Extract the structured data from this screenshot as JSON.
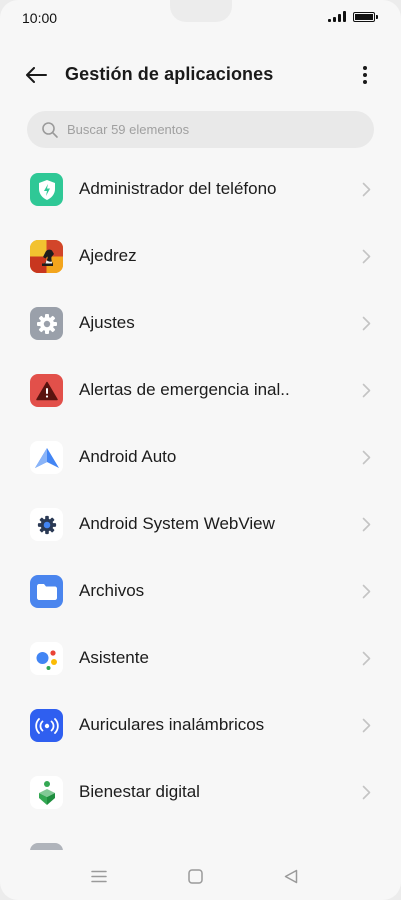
{
  "status_bar": {
    "time": "10:00"
  },
  "header": {
    "title": "Gestión de aplicaciones"
  },
  "search": {
    "placeholder": "Buscar 59 elementos"
  },
  "apps": [
    {
      "label": "Administrador del teléfono",
      "icon": "shield-icon",
      "color": "#2fc896"
    },
    {
      "label": "Ajedrez",
      "icon": "chess-icon",
      "color": "#e8a020"
    },
    {
      "label": "Ajustes",
      "icon": "gear-icon",
      "color": "#9aa0aa"
    },
    {
      "label": "Alertas de emergencia inal..",
      "icon": "warning-icon",
      "color": "#e2504a"
    },
    {
      "label": "Android Auto",
      "icon": "android-auto-icon",
      "color": "#4285f4"
    },
    {
      "label": "Android System WebView",
      "icon": "webview-gear-icon",
      "color": "#2b3a55"
    },
    {
      "label": "Archivos",
      "icon": "folder-icon",
      "color": "#4a85ee"
    },
    {
      "label": "Asistente",
      "icon": "assistant-icon",
      "color": "#4285f4"
    },
    {
      "label": "Auriculares inalámbricos",
      "icon": "wireless-icon",
      "color": "#2f5ff0"
    },
    {
      "label": "Bienestar digital",
      "icon": "wellbeing-icon",
      "color": "#34a853"
    }
  ],
  "navigation": {
    "menu": "menu-icon",
    "home": "home-icon",
    "back": "back-icon"
  }
}
